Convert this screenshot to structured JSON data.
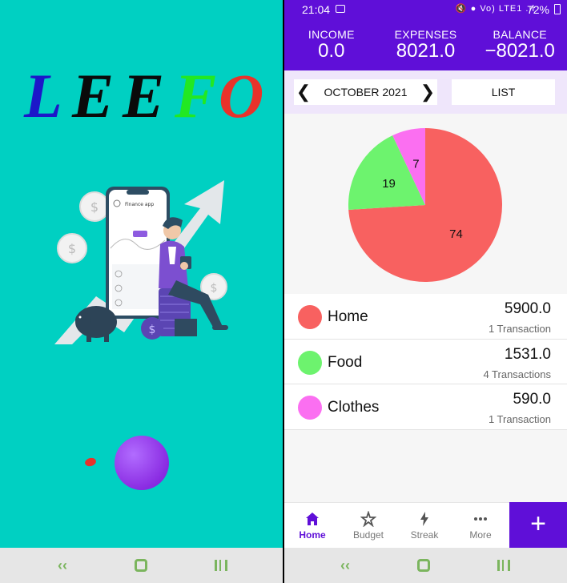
{
  "splash": {
    "logo_letters": [
      {
        "ch": "L",
        "color": "#1c17c9"
      },
      {
        "ch": "E",
        "color": "#0a0a0a"
      },
      {
        "ch": "E",
        "color": "#0a0a0a"
      },
      {
        "ch": "F",
        "color": "#22e822"
      },
      {
        "ch": "O",
        "color": "#e8322b"
      }
    ],
    "phone_title": "Finance app"
  },
  "status": {
    "time": "21:04",
    "battery": "72%",
    "network": "Vo) LTE1"
  },
  "summary": {
    "income_label": "INCOME",
    "income_value": "0.0",
    "expenses_label": "EXPENSES",
    "expenses_value": "8021.0",
    "balance_label": "BALANCE",
    "balance_value": "−8021.0"
  },
  "controls": {
    "month": "OCTOBER 2021",
    "list_label": "LIST"
  },
  "chart_data": {
    "type": "pie",
    "slices": [
      {
        "name": "Home",
        "value": 74,
        "color": "#f86160"
      },
      {
        "name": "Food",
        "value": 19,
        "color": "#6df36e"
      },
      {
        "name": "Clothes",
        "value": 7,
        "color": "#fb6ff1"
      }
    ]
  },
  "categories": [
    {
      "name": "Home",
      "amount": "5900.0",
      "count": "1 Transaction",
      "color": "#f86160"
    },
    {
      "name": "Food",
      "amount": "1531.0",
      "count": "4 Transactions",
      "color": "#6df36e"
    },
    {
      "name": "Clothes",
      "amount": "590.0",
      "count": "1 Transaction",
      "color": "#fb6ff1"
    }
  ],
  "nav": {
    "home": "Home",
    "budget": "Budget",
    "streak": "Streak",
    "more": "More",
    "add": "+"
  },
  "colors": {
    "primary": "#5f0fd8",
    "splash_bg": "#00d0c2"
  }
}
